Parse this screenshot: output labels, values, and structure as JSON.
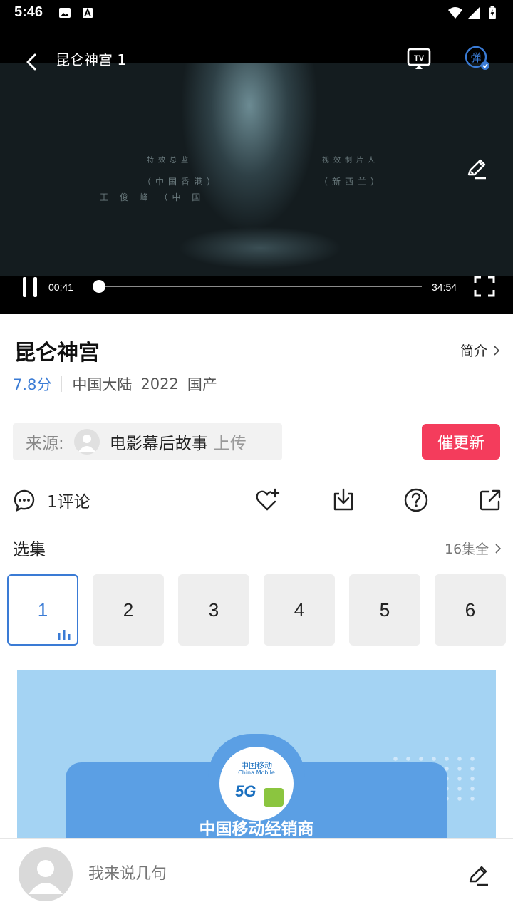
{
  "status_bar": {
    "time": "5:46"
  },
  "player": {
    "title": "昆仑神宫 1",
    "current_time": "00:41",
    "total_time": "34:54",
    "progress": 0.0196,
    "credits": [
      "特效总监",
      "视效制片人",
      "（中国香港）",
      "（新西兰）",
      "王 俊 峰 （中 国"
    ],
    "danmu_label": "弹",
    "tv_label": "TV"
  },
  "show": {
    "title": "昆仑神宫",
    "intro_label": "简介",
    "rating": "7.8分",
    "region": "中国大陆",
    "year": "2022",
    "origin": "国产"
  },
  "source": {
    "label": "来源:",
    "name": "电影幕后故事",
    "action": "上传"
  },
  "urge_button": "催更新",
  "actions": {
    "comment_count": "1评论"
  },
  "episodes": {
    "title": "选集",
    "total": "16集全",
    "items": [
      "1",
      "2",
      "3",
      "4",
      "5",
      "6"
    ],
    "active_index": 0
  },
  "ad": {
    "text": "中国移动经销商",
    "logo_cn": "中国移动",
    "logo_en": "China Mobile",
    "logo_5g": "5G"
  },
  "comment_bar": {
    "placeholder": "我来说几句"
  },
  "colors": {
    "accent": "#3a7bd5",
    "urge": "#f43c5c"
  }
}
